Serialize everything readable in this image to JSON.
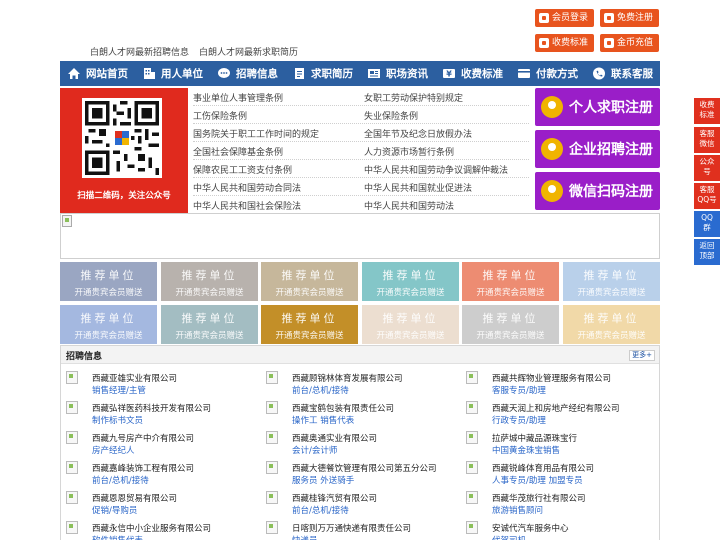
{
  "top_buttons": {
    "member_login": "会员登录",
    "free_register": "免费注册",
    "fee_standard": "收费标准",
    "gold_recharge": "金币充值"
  },
  "top_links": [
    "白朗人才网最新招聘信息",
    "白朗人才网最新求职简历"
  ],
  "nav": [
    {
      "label": "网站首页",
      "icon": "home-icon"
    },
    {
      "label": "用人单位",
      "icon": "building-icon"
    },
    {
      "label": "招聘信息",
      "icon": "chat-icon"
    },
    {
      "label": "求职简历",
      "icon": "document-icon"
    },
    {
      "label": "职场资讯",
      "icon": "news-icon"
    },
    {
      "label": "收费标准",
      "icon": "money-icon"
    },
    {
      "label": "付款方式",
      "icon": "card-icon"
    },
    {
      "label": "联系客服",
      "icon": "phone-icon"
    }
  ],
  "qr_caption": "扫描二维码，关注公众号",
  "policies": {
    "left": [
      "事业单位人事管理条例",
      "工伤保险条例",
      "国务院关于职工工作时间的规定",
      "全国社会保障基金条例",
      "保障农民工工资支付条例",
      "中华人民共和国劳动合同法",
      "中华人民共和国社会保险法"
    ],
    "right": [
      "女职工劳动保护特别规定",
      "失业保险条例",
      "全国年节及纪念日放假办法",
      "人力资源市场暂行条例",
      "中华人民共和国劳动争议调解仲裁法",
      "中华人民共和国就业促进法",
      "中华人民共和国劳动法"
    ]
  },
  "register": {
    "personal": "个人求职注册",
    "company": "企业招聘注册",
    "wechat": "微信扫码注册"
  },
  "side": {
    "fee": "收费\n标准",
    "service_wechat": "客服\n微信",
    "official": "公众\n号",
    "service_qq": "客服\nQQ号",
    "qq_group": "QQ\n群",
    "back_top": "返回\n顶部"
  },
  "tiles": {
    "title": "推荐单位",
    "subtitle": "开通贵宾会员赠送",
    "colors": [
      "#9aa6c2",
      "#b8b2ad",
      "#c6b79b",
      "#84c6c8",
      "#ed8c72",
      "#b9d0ea",
      "#a4b8e0",
      "#a3bdc2",
      "#c38f28",
      "#ecded0",
      "#cdcdcd",
      "#f1d9a8"
    ]
  },
  "jobs": {
    "title": "招聘信息",
    "more": "更多+",
    "rows": [
      [
        {
          "company": "西藏亚雄实业有限公司",
          "job": "销售经理/主管"
        },
        {
          "company": "西藏顾锦林体育发展有限公司",
          "job": "前台/总机/接待"
        },
        {
          "company": "西藏共辉物业管理服务有限公司",
          "job": "客服专员/助理"
        }
      ],
      [
        {
          "company": "西藏弘祥医药科技开发有限公司",
          "job": "制作标书文员"
        },
        {
          "company": "西藏宝鹤包装有限责任公司",
          "job": "操作工  销售代表"
        },
        {
          "company": "西藏天润上和房地产经纪有限公司",
          "job": "行政专员/助理"
        }
      ],
      [
        {
          "company": "西藏九号房产中介有限公司",
          "job": "房产经纪人"
        },
        {
          "company": "西藏奥通实业有限公司",
          "job": "会计/会计师"
        },
        {
          "company": "拉萨城中藏品源珠宝行",
          "job": "中国黄金珠宝销售"
        }
      ],
      [
        {
          "company": "西藏嘉峰装饰工程有限公司",
          "job": "前台/总机/接待"
        },
        {
          "company": "西藏大德餐饮管理有限公司第五分公司",
          "job": "服务员  外送骑手"
        },
        {
          "company": "西藏锐峰体育用品有限公司",
          "job": "人事专员/助理  加盟专员"
        }
      ],
      [
        {
          "company": "西藏恩恩贸易有限公司",
          "job": "促销/导购员"
        },
        {
          "company": "西藏桂锋汽贸有限公司",
          "job": "前台/总机/接待"
        },
        {
          "company": "西藏华茂旅行社有限公司",
          "job": "旅游销售顾问"
        }
      ],
      [
        {
          "company": "西藏永信中小企业服务有限公司",
          "job": "软件销售代表"
        },
        {
          "company": "日喀则万万通快递有限责任公司",
          "job": "快递员"
        },
        {
          "company": "安诚代汽车服务中心",
          "job": "代驾司机"
        }
      ]
    ]
  },
  "colors": {
    "nav": "#2c5fa0",
    "orange": "#e8541e",
    "purple": "#9a1ec8",
    "side_red": "#e0301e",
    "side_blue": "#2a6bd0",
    "link_blue": "#2a66c8"
  }
}
